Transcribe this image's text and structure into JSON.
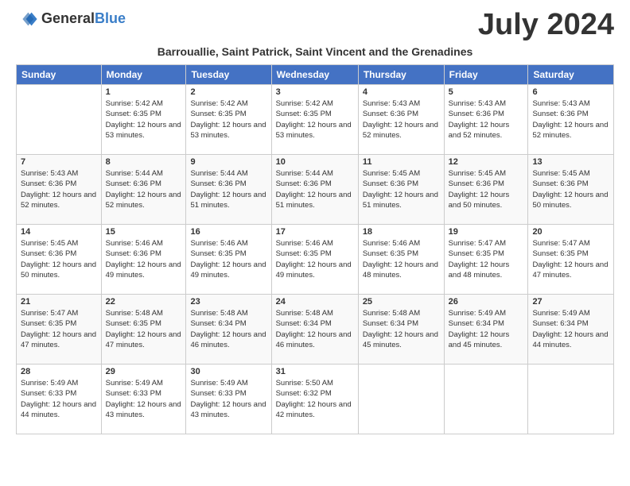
{
  "header": {
    "logo_general": "General",
    "logo_blue": "Blue",
    "month_title": "July 2024",
    "subtitle": "Barrouallie, Saint Patrick, Saint Vincent and the Grenadines"
  },
  "days_of_week": [
    "Sunday",
    "Monday",
    "Tuesday",
    "Wednesday",
    "Thursday",
    "Friday",
    "Saturday"
  ],
  "weeks": [
    [
      {
        "day": "",
        "sunrise": "",
        "sunset": "",
        "daylight": ""
      },
      {
        "day": "1",
        "sunrise": "Sunrise: 5:42 AM",
        "sunset": "Sunset: 6:35 PM",
        "daylight": "Daylight: 12 hours and 53 minutes."
      },
      {
        "day": "2",
        "sunrise": "Sunrise: 5:42 AM",
        "sunset": "Sunset: 6:35 PM",
        "daylight": "Daylight: 12 hours and 53 minutes."
      },
      {
        "day": "3",
        "sunrise": "Sunrise: 5:42 AM",
        "sunset": "Sunset: 6:35 PM",
        "daylight": "Daylight: 12 hours and 53 minutes."
      },
      {
        "day": "4",
        "sunrise": "Sunrise: 5:43 AM",
        "sunset": "Sunset: 6:36 PM",
        "daylight": "Daylight: 12 hours and 52 minutes."
      },
      {
        "day": "5",
        "sunrise": "Sunrise: 5:43 AM",
        "sunset": "Sunset: 6:36 PM",
        "daylight": "Daylight: 12 hours and 52 minutes."
      },
      {
        "day": "6",
        "sunrise": "Sunrise: 5:43 AM",
        "sunset": "Sunset: 6:36 PM",
        "daylight": "Daylight: 12 hours and 52 minutes."
      }
    ],
    [
      {
        "day": "7",
        "sunrise": "Sunrise: 5:43 AM",
        "sunset": "Sunset: 6:36 PM",
        "daylight": "Daylight: 12 hours and 52 minutes."
      },
      {
        "day": "8",
        "sunrise": "Sunrise: 5:44 AM",
        "sunset": "Sunset: 6:36 PM",
        "daylight": "Daylight: 12 hours and 52 minutes."
      },
      {
        "day": "9",
        "sunrise": "Sunrise: 5:44 AM",
        "sunset": "Sunset: 6:36 PM",
        "daylight": "Daylight: 12 hours and 51 minutes."
      },
      {
        "day": "10",
        "sunrise": "Sunrise: 5:44 AM",
        "sunset": "Sunset: 6:36 PM",
        "daylight": "Daylight: 12 hours and 51 minutes."
      },
      {
        "day": "11",
        "sunrise": "Sunrise: 5:45 AM",
        "sunset": "Sunset: 6:36 PM",
        "daylight": "Daylight: 12 hours and 51 minutes."
      },
      {
        "day": "12",
        "sunrise": "Sunrise: 5:45 AM",
        "sunset": "Sunset: 6:36 PM",
        "daylight": "Daylight: 12 hours and 50 minutes."
      },
      {
        "day": "13",
        "sunrise": "Sunrise: 5:45 AM",
        "sunset": "Sunset: 6:36 PM",
        "daylight": "Daylight: 12 hours and 50 minutes."
      }
    ],
    [
      {
        "day": "14",
        "sunrise": "Sunrise: 5:45 AM",
        "sunset": "Sunset: 6:36 PM",
        "daylight": "Daylight: 12 hours and 50 minutes."
      },
      {
        "day": "15",
        "sunrise": "Sunrise: 5:46 AM",
        "sunset": "Sunset: 6:36 PM",
        "daylight": "Daylight: 12 hours and 49 minutes."
      },
      {
        "day": "16",
        "sunrise": "Sunrise: 5:46 AM",
        "sunset": "Sunset: 6:35 PM",
        "daylight": "Daylight: 12 hours and 49 minutes."
      },
      {
        "day": "17",
        "sunrise": "Sunrise: 5:46 AM",
        "sunset": "Sunset: 6:35 PM",
        "daylight": "Daylight: 12 hours and 49 minutes."
      },
      {
        "day": "18",
        "sunrise": "Sunrise: 5:46 AM",
        "sunset": "Sunset: 6:35 PM",
        "daylight": "Daylight: 12 hours and 48 minutes."
      },
      {
        "day": "19",
        "sunrise": "Sunrise: 5:47 AM",
        "sunset": "Sunset: 6:35 PM",
        "daylight": "Daylight: 12 hours and 48 minutes."
      },
      {
        "day": "20",
        "sunrise": "Sunrise: 5:47 AM",
        "sunset": "Sunset: 6:35 PM",
        "daylight": "Daylight: 12 hours and 47 minutes."
      }
    ],
    [
      {
        "day": "21",
        "sunrise": "Sunrise: 5:47 AM",
        "sunset": "Sunset: 6:35 PM",
        "daylight": "Daylight: 12 hours and 47 minutes."
      },
      {
        "day": "22",
        "sunrise": "Sunrise: 5:48 AM",
        "sunset": "Sunset: 6:35 PM",
        "daylight": "Daylight: 12 hours and 47 minutes."
      },
      {
        "day": "23",
        "sunrise": "Sunrise: 5:48 AM",
        "sunset": "Sunset: 6:34 PM",
        "daylight": "Daylight: 12 hours and 46 minutes."
      },
      {
        "day": "24",
        "sunrise": "Sunrise: 5:48 AM",
        "sunset": "Sunset: 6:34 PM",
        "daylight": "Daylight: 12 hours and 46 minutes."
      },
      {
        "day": "25",
        "sunrise": "Sunrise: 5:48 AM",
        "sunset": "Sunset: 6:34 PM",
        "daylight": "Daylight: 12 hours and 45 minutes."
      },
      {
        "day": "26",
        "sunrise": "Sunrise: 5:49 AM",
        "sunset": "Sunset: 6:34 PM",
        "daylight": "Daylight: 12 hours and 45 minutes."
      },
      {
        "day": "27",
        "sunrise": "Sunrise: 5:49 AM",
        "sunset": "Sunset: 6:34 PM",
        "daylight": "Daylight: 12 hours and 44 minutes."
      }
    ],
    [
      {
        "day": "28",
        "sunrise": "Sunrise: 5:49 AM",
        "sunset": "Sunset: 6:33 PM",
        "daylight": "Daylight: 12 hours and 44 minutes."
      },
      {
        "day": "29",
        "sunrise": "Sunrise: 5:49 AM",
        "sunset": "Sunset: 6:33 PM",
        "daylight": "Daylight: 12 hours and 43 minutes."
      },
      {
        "day": "30",
        "sunrise": "Sunrise: 5:49 AM",
        "sunset": "Sunset: 6:33 PM",
        "daylight": "Daylight: 12 hours and 43 minutes."
      },
      {
        "day": "31",
        "sunrise": "Sunrise: 5:50 AM",
        "sunset": "Sunset: 6:32 PM",
        "daylight": "Daylight: 12 hours and 42 minutes."
      },
      {
        "day": "",
        "sunrise": "",
        "sunset": "",
        "daylight": ""
      },
      {
        "day": "",
        "sunrise": "",
        "sunset": "",
        "daylight": ""
      },
      {
        "day": "",
        "sunrise": "",
        "sunset": "",
        "daylight": ""
      }
    ]
  ]
}
